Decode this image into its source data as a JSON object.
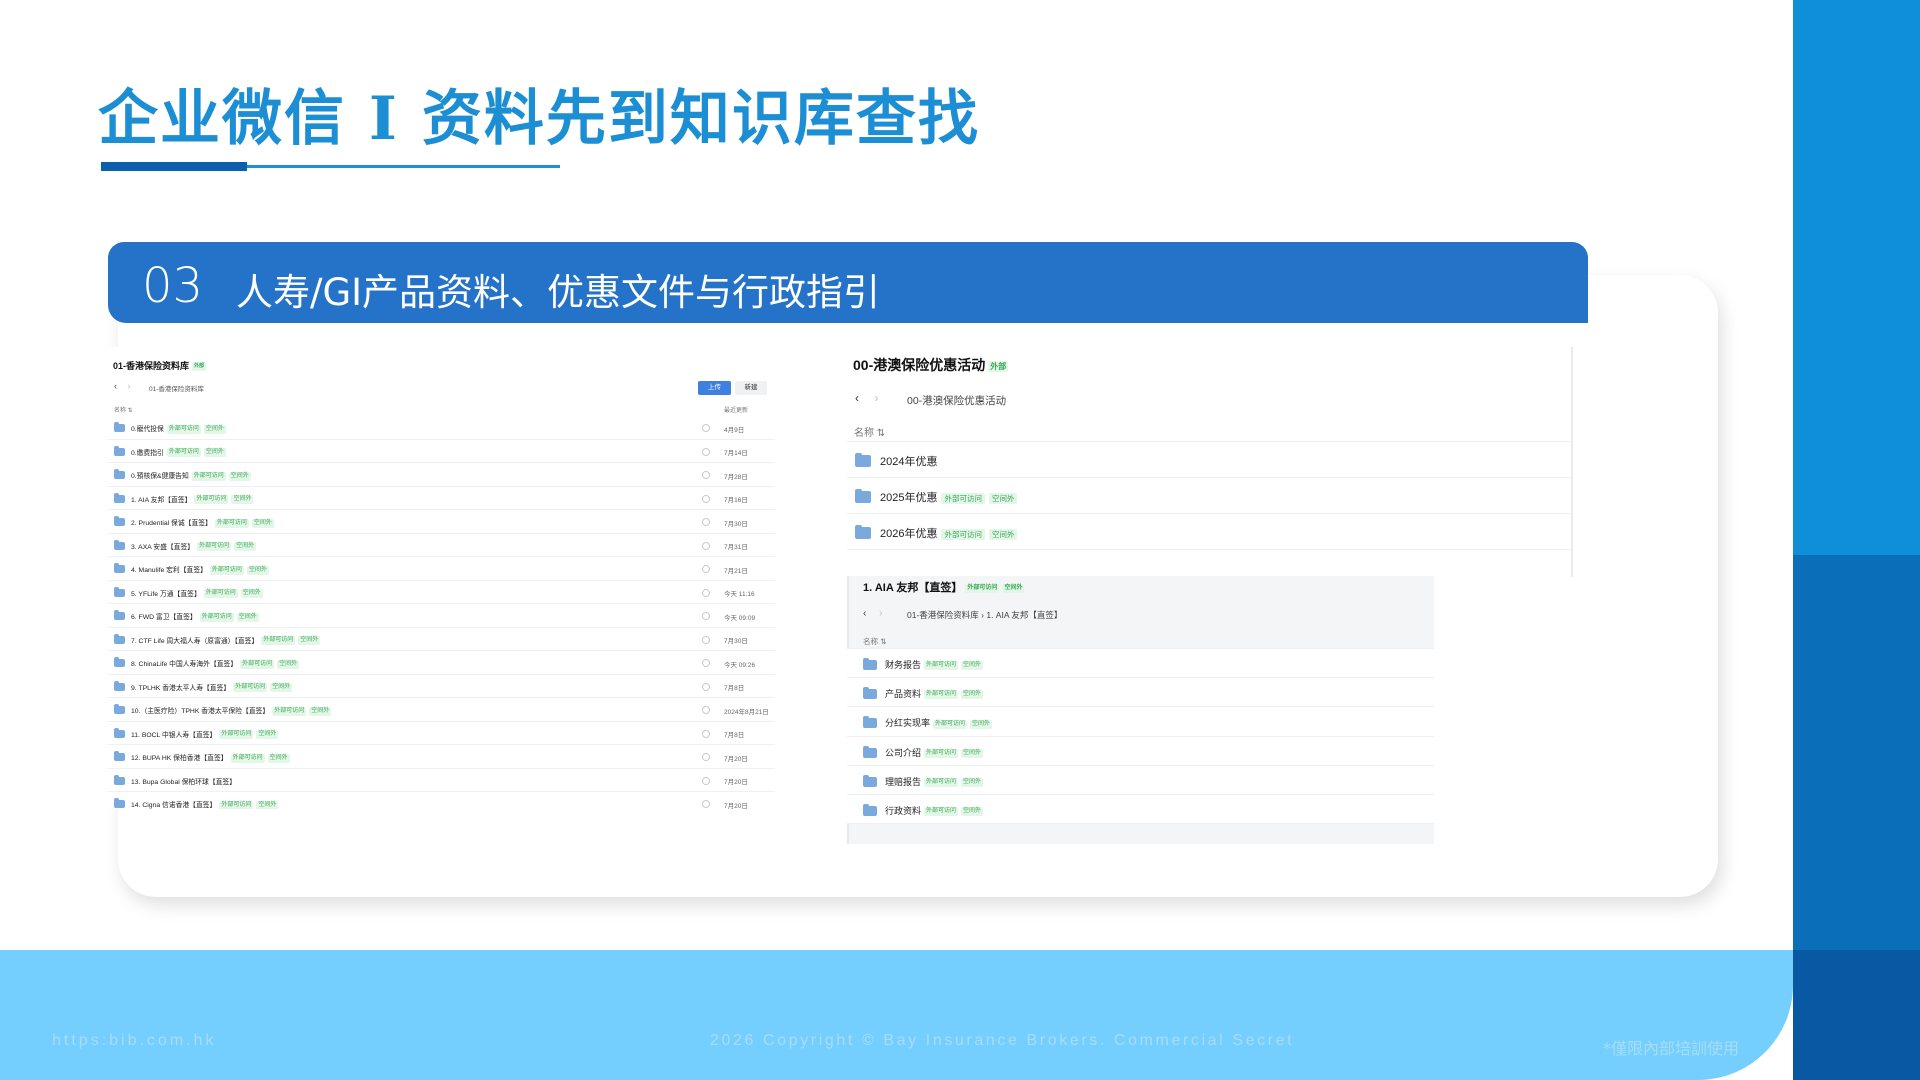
{
  "page": {
    "title": "企业微信 I 资料先到知识库查找"
  },
  "section": {
    "number": "03",
    "title": "人寿/GI产品资料、优惠文件与行政指引"
  },
  "panel_a": {
    "title": "01-香港保险资料库",
    "title_tag": "外部",
    "back_icon": "‹",
    "forward_icon": "›",
    "breadcrumb": "01-香港保险资料库",
    "upload_label": "上传",
    "new_label": "新建",
    "col_name": "名称 ⇅",
    "col_updated": "最近更新",
    "rows": [
      {
        "name": "0.寵代投保",
        "tags": [
          "外部可访问",
          "空间外"
        ],
        "date": "4月9日"
      },
      {
        "name": "0.缴费指引",
        "tags": [
          "外部可访问",
          "空间外"
        ],
        "date": "7月14日"
      },
      {
        "name": "0.預核保&健康告知",
        "tags": [
          "外部可访问",
          "空间外"
        ],
        "date": "7月28日"
      },
      {
        "name": "1. AIA 友邦【直签】",
        "tags": [
          "外部可访问",
          "空间外"
        ],
        "date": "7月16日"
      },
      {
        "name": "2. Prudential 保诚【直签】",
        "tags": [
          "外部可访问",
          "空间外"
        ],
        "date": "7月30日"
      },
      {
        "name": "3. AXA 安盛【直签】",
        "tags": [
          "外部可访问",
          "空间外"
        ],
        "date": "7月31日"
      },
      {
        "name": "4. Manulife 宏利【直签】",
        "tags": [
          "外部可访问",
          "空间外"
        ],
        "date": "7月21日"
      },
      {
        "name": "5. YFLife 万通【直签】",
        "tags": [
          "外部可访问",
          "空间外"
        ],
        "date": "今天 11:16"
      },
      {
        "name": "6. FWD 富卫【直签】",
        "tags": [
          "外部可访问",
          "空间外"
        ],
        "date": "今天 09:09"
      },
      {
        "name": "7. CTF Life 周大福人寿（原富通）【直签】",
        "tags": [
          "外部可访问",
          "空间外"
        ],
        "date": "7月30日"
      },
      {
        "name": "8. ChinaLife 中国人寿海外【直签】",
        "tags": [
          "外部可访问",
          "空间外"
        ],
        "date": "今天 09:26"
      },
      {
        "name": "9. TPLHK 香港太平人寿【直签】",
        "tags": [
          "外部可访问",
          "空间外"
        ],
        "date": "7月8日"
      },
      {
        "name": "10.（主医疗险）TPHK 香港太平保险【直签】",
        "tags": [
          "外部可访问",
          "空间外"
        ],
        "date": "2024年8月21日"
      },
      {
        "name": "11. BOCL 中银人寿【直签】",
        "tags": [
          "外部可访问",
          "空间外"
        ],
        "date": "7月8日"
      },
      {
        "name": "12. BUPA HK 保柏香港【直签】",
        "tags": [
          "外部可访问",
          "空间外"
        ],
        "date": "7月20日"
      },
      {
        "name": "13. Bupa Global 保柏环球【直签】",
        "tags": [],
        "date": "7月20日"
      },
      {
        "name": "14. Cigna 信诺香港【直签】",
        "tags": [
          "外部可访问",
          "空间外"
        ],
        "date": "7月20日"
      }
    ]
  },
  "panel_b": {
    "title": "00-港澳保险优惠活动",
    "title_tag": "外部",
    "back_icon": "‹",
    "forward_icon": "›",
    "breadcrumb": "00-港澳保险优惠活动",
    "col_name": "名称 ⇅",
    "rows": [
      {
        "name": "2024年优惠",
        "tags": []
      },
      {
        "name": "2025年优惠",
        "tags": [
          "外部可访问",
          "空间外"
        ]
      },
      {
        "name": "2026年优惠",
        "tags": [
          "外部可访问",
          "空间外"
        ]
      }
    ]
  },
  "panel_c": {
    "title": "1. AIA 友邦【直签】",
    "title_tags": [
      "外部可访问",
      "空间外"
    ],
    "back_icon": "‹",
    "forward_icon": "›",
    "breadcrumb": "01-香港保险资料库 › 1. AIA 友邦【直签】",
    "col_name": "名称 ⇅",
    "rows": [
      {
        "name": "财务报告",
        "tags": [
          "外部可访问",
          "空间外"
        ]
      },
      {
        "name": "产品资料",
        "tags": [
          "外部可访问",
          "空间外"
        ]
      },
      {
        "name": "分红实现率",
        "tags": [
          "外部可访问",
          "空间外"
        ]
      },
      {
        "name": "公司介绍",
        "tags": [
          "外部可访问",
          "空间外"
        ]
      },
      {
        "name": "理赔报告",
        "tags": [
          "外部可访问",
          "空间外"
        ]
      },
      {
        "name": "行政资料",
        "tags": [
          "外部可访问",
          "空间外"
        ]
      }
    ]
  },
  "footer": {
    "url": "https:bib.com.hk",
    "copyright": "2026 Copyright © Bay Insurance Brokers. Commercial Secret",
    "note": "*僅限內部培訓使用"
  },
  "colors": {
    "title_blue": "#1c8ed4",
    "banner_blue": "#2572c9",
    "footer_light_blue": "#74cffe",
    "side_blue": "#0e8fd8",
    "tag_green": "#3aa957"
  }
}
